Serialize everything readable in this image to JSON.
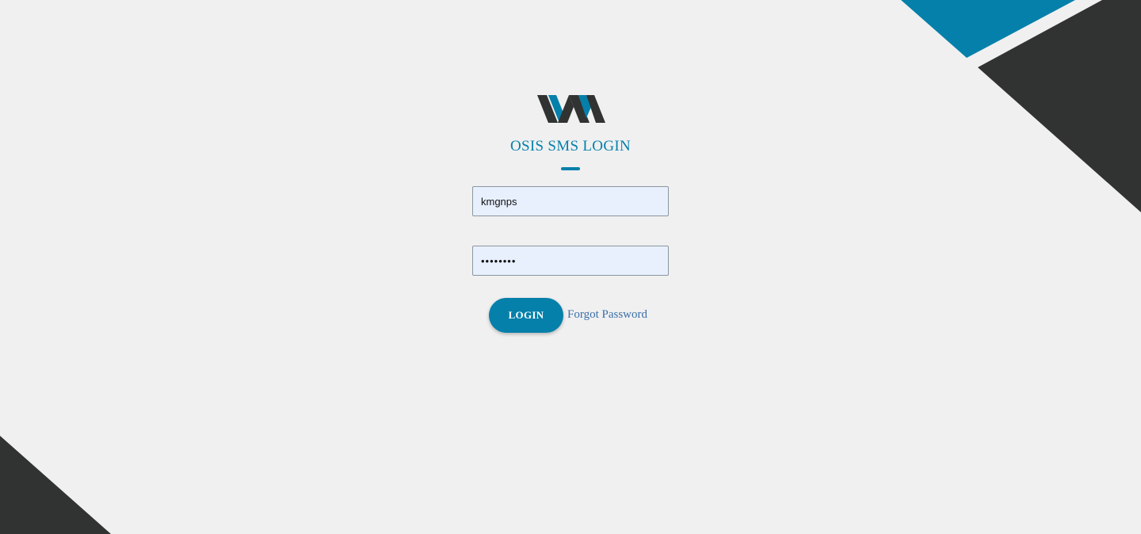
{
  "colors": {
    "accent": "#0580aa",
    "dark": "#313332",
    "background": "#f0f0f1",
    "input_fill": "#e8f0fe",
    "link": "#3a6fa8"
  },
  "logo": {
    "icon": "osis-logo-icon"
  },
  "login": {
    "title": "OSIS SMS LOGIN",
    "username_value": "kmgnps",
    "password_value": "••••••••",
    "login_label": "LOGIN",
    "forgot_label": "Forgot Password"
  }
}
